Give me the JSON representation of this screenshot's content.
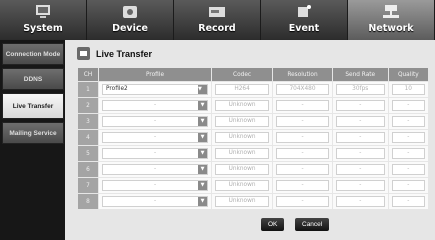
{
  "topbar": {
    "items": [
      {
        "label": "System",
        "icon": "computer-icon"
      },
      {
        "label": "Device",
        "icon": "camera-icon"
      },
      {
        "label": "Record",
        "icon": "hdd-icon"
      },
      {
        "label": "Event",
        "icon": "bell-icon"
      },
      {
        "label": "Network",
        "icon": "network-icon"
      }
    ],
    "active": "Network"
  },
  "sidebar": {
    "items": [
      {
        "label": "Connection Mode"
      },
      {
        "label": "DDNS"
      },
      {
        "label": "Live Transfer"
      },
      {
        "label": "Mailing Service"
      }
    ],
    "active": "Live Transfer"
  },
  "page": {
    "title": "Live Transfer",
    "title_icon": "live-transfer-icon"
  },
  "table": {
    "headers": [
      "CH",
      "Profile",
      "Codec",
      "Resolution",
      "Send Rate",
      "Quality"
    ],
    "rows": [
      {
        "ch": "1",
        "profile": "Profile2",
        "codec": "H264",
        "resolution": "704X480",
        "rate": "30fps",
        "quality": "10"
      },
      {
        "ch": "2",
        "profile": "-",
        "codec": "Unknown",
        "resolution": "-",
        "rate": "-",
        "quality": "-"
      },
      {
        "ch": "3",
        "profile": "-",
        "codec": "Unknown",
        "resolution": "-",
        "rate": "-",
        "quality": "-"
      },
      {
        "ch": "4",
        "profile": "-",
        "codec": "Unknown",
        "resolution": "-",
        "rate": "-",
        "quality": "-"
      },
      {
        "ch": "5",
        "profile": "-",
        "codec": "Unknown",
        "resolution": "-",
        "rate": "-",
        "quality": "-"
      },
      {
        "ch": "6",
        "profile": "-",
        "codec": "Unknown",
        "resolution": "-",
        "rate": "-",
        "quality": "-"
      },
      {
        "ch": "7",
        "profile": "-",
        "codec": "Unknown",
        "resolution": "-",
        "rate": "-",
        "quality": "-"
      },
      {
        "ch": "8",
        "profile": "-",
        "codec": "Unknown",
        "resolution": "-",
        "rate": "-",
        "quality": "-"
      }
    ]
  },
  "buttons": {
    "ok": "OK",
    "cancel": "Cancel"
  },
  "colors": {
    "active_tab": "#8a8a8a",
    "header": "#8f8f8f",
    "content_bg": "#e6e6e6"
  }
}
